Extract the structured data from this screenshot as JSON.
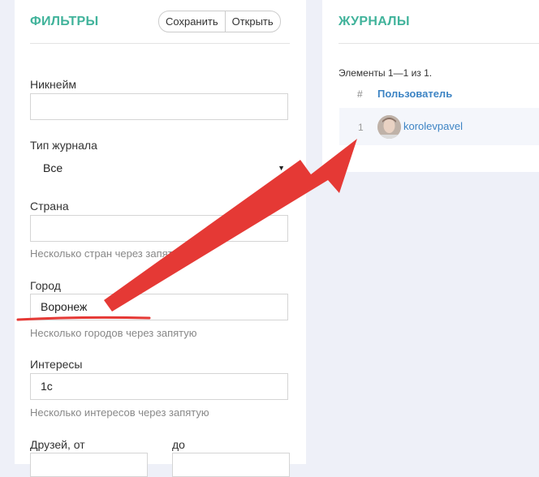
{
  "filters": {
    "title": "ФИЛЬТРЫ",
    "save_label": "Сохранить",
    "open_label": "Открыть",
    "nickname": {
      "label": "Никнейм",
      "value": ""
    },
    "journal_type": {
      "label": "Тип журнала",
      "value": "Все"
    },
    "country": {
      "label": "Страна",
      "value": "",
      "help": "Несколько стран через запятую"
    },
    "city": {
      "label": "Город",
      "value": "Воронеж",
      "help": "Несколько городов через запятую"
    },
    "interests": {
      "label": "Интересы",
      "value": "1с",
      "help": "Несколько интересов через запятую"
    },
    "friends": {
      "from_label": "Друзей, от",
      "to_label": "до"
    }
  },
  "journals": {
    "title": "ЖУРНАЛЫ",
    "summary": "Элементы 1—1 из 1.",
    "columns": [
      "#",
      "Пользователь"
    ],
    "rows": [
      {
        "num": "1",
        "user": "korolevpavel"
      }
    ]
  },
  "annotation": {
    "color": "#e53935"
  }
}
